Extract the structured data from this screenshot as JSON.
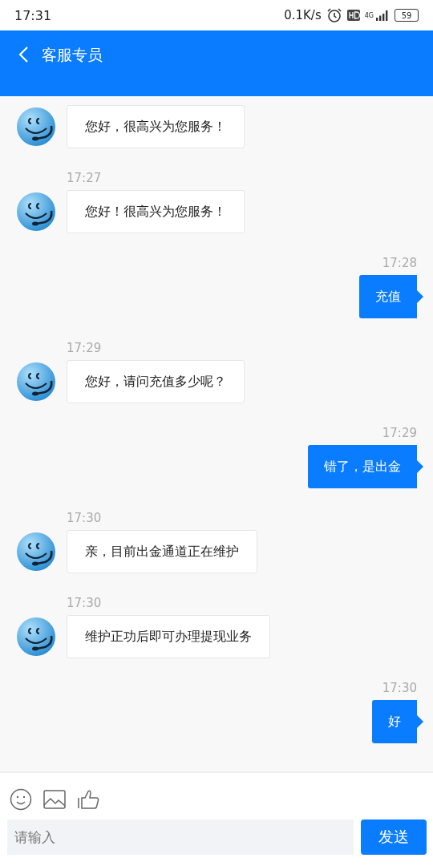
{
  "status_bar": {
    "time": "17:31",
    "speed": "0.1K/s",
    "network": "4G",
    "battery": "59"
  },
  "header": {
    "title": "客服专员"
  },
  "messages": [
    {
      "kind": "received",
      "text": "您好，很高兴为您服务！"
    },
    {
      "kind": "received",
      "time": "17:27",
      "text": "您好！很高兴为您服务！"
    },
    {
      "kind": "sent",
      "time": "17:28",
      "text": "充值"
    },
    {
      "kind": "received",
      "time": "17:29",
      "text": "您好，请问充值多少呢？"
    },
    {
      "kind": "sent",
      "time": "17:29",
      "text": "错了，是出金"
    },
    {
      "kind": "received",
      "time": "17:30",
      "text": "亲，目前出金通道正在维护"
    },
    {
      "kind": "received",
      "time": "17:30",
      "text": "维护正功后即可办理提现业务"
    },
    {
      "kind": "sent",
      "time": "17:30",
      "text": "好"
    }
  ],
  "composer": {
    "placeholder": "请输入",
    "send": "发送"
  }
}
